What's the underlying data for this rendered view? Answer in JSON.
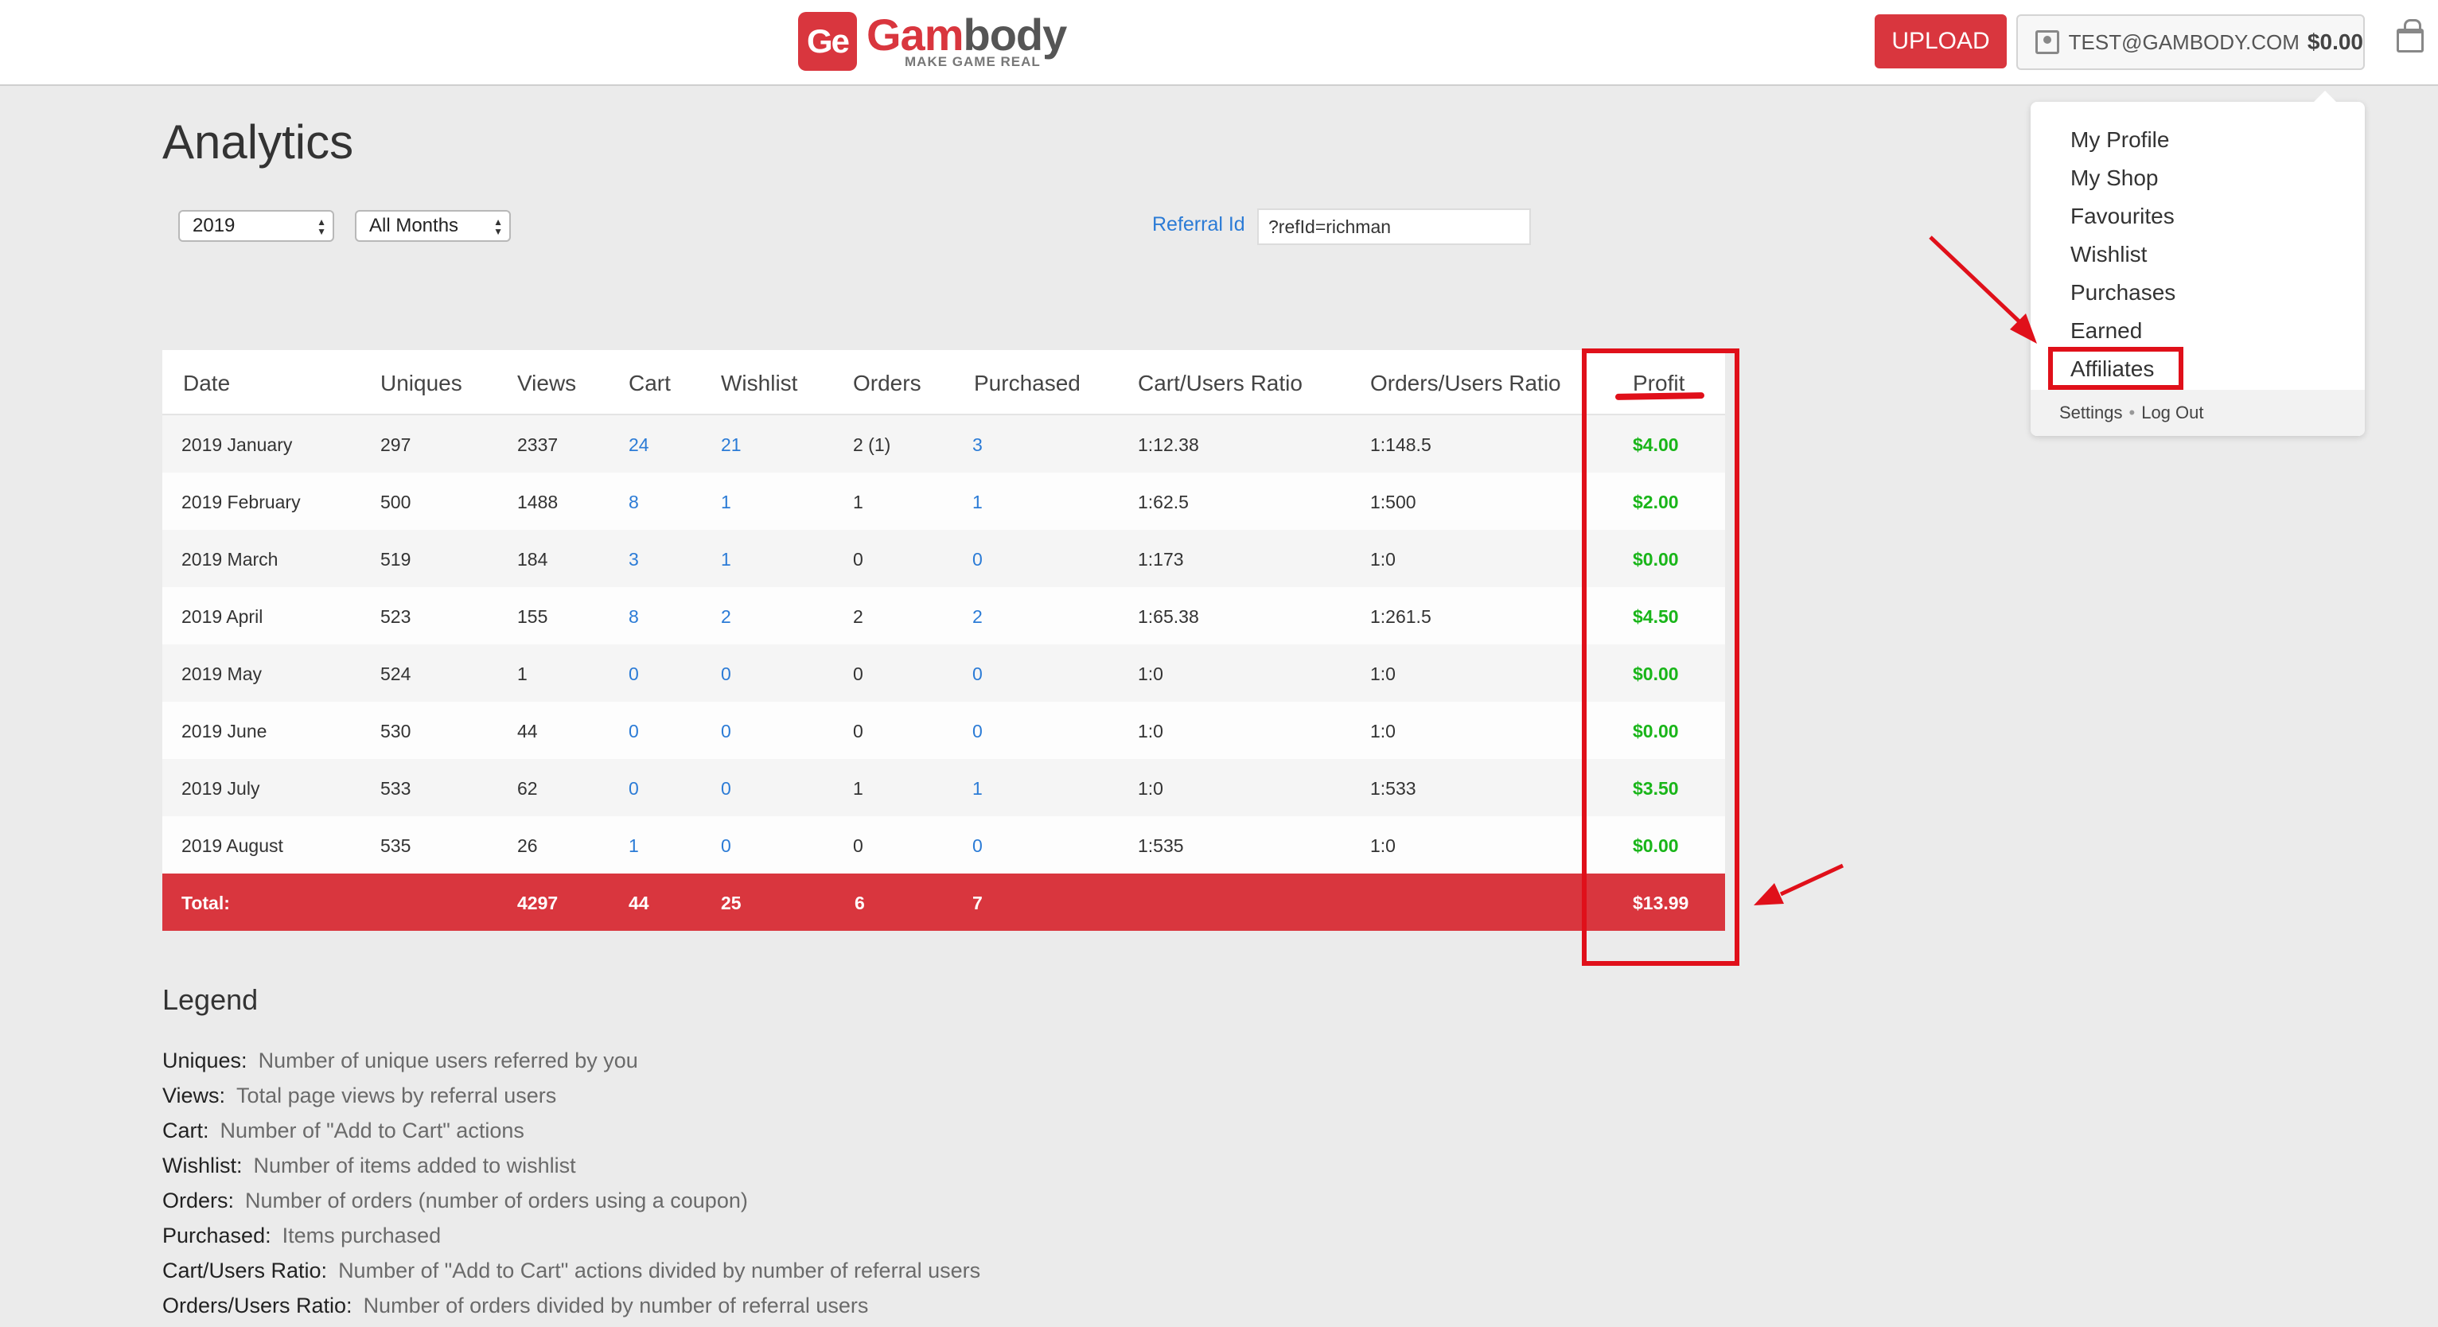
{
  "header": {
    "logo_mark": "Ge",
    "logo_word_1": "Gam",
    "logo_word_2": "body",
    "logo_tagline": "MAKE GAME REAL",
    "upload_label": "UPLOAD",
    "account_email": "TEST@GAMBODY.COM",
    "account_balance": "$0.00"
  },
  "menu": {
    "items": [
      "My Profile",
      "My Shop",
      "Favourites",
      "Wishlist",
      "Purchases",
      "Earned",
      "Affiliates"
    ],
    "settings": "Settings",
    "separator": "•",
    "logout": "Log Out"
  },
  "page": {
    "title": "Analytics",
    "year_select": "2019",
    "month_select": "All Months",
    "referral_label": "Referral Id",
    "referral_value": "?refId=richman"
  },
  "table": {
    "headers": [
      "Date",
      "Uniques",
      "Views",
      "Cart",
      "Wishlist",
      "Orders",
      "Purchased",
      "Cart/Users Ratio",
      "Orders/Users Ratio",
      "Profit"
    ],
    "rows": [
      [
        "2019 January",
        "297",
        "2337",
        "24",
        "21",
        "2 (1)",
        "3",
        "1:12.38",
        "1:148.5",
        "$4.00"
      ],
      [
        "2019 February",
        "500",
        "1488",
        "8",
        "1",
        "1",
        "1",
        "1:62.5",
        "1:500",
        "$2.00"
      ],
      [
        "2019 March",
        "519",
        "184",
        "3",
        "1",
        "0",
        "0",
        "1:173",
        "1:0",
        "$0.00"
      ],
      [
        "2019 April",
        "523",
        "155",
        "8",
        "2",
        "2",
        "2",
        "1:65.38",
        "1:261.5",
        "$4.50"
      ],
      [
        "2019 May",
        "524",
        "1",
        "0",
        "0",
        "0",
        "0",
        "1:0",
        "1:0",
        "$0.00"
      ],
      [
        "2019 June",
        "530",
        "44",
        "0",
        "0",
        "0",
        "0",
        "1:0",
        "1:0",
        "$0.00"
      ],
      [
        "2019 July",
        "533",
        "62",
        "0",
        "0",
        "1",
        "1",
        "1:0",
        "1:533",
        "$3.50"
      ],
      [
        "2019 August",
        "535",
        "26",
        "1",
        "0",
        "0",
        "0",
        "1:535",
        "1:0",
        "$0.00"
      ]
    ],
    "total": {
      "label": "Total:",
      "views": "4297",
      "cart": "44",
      "wishlist": "25",
      "orders": "6",
      "purchased": "7",
      "profit": "$13.99"
    }
  },
  "legend": {
    "title": "Legend",
    "items": [
      {
        "term": "Uniques:",
        "desc": "Number of unique users referred by you"
      },
      {
        "term": "Views:",
        "desc": "Total page views by referral users"
      },
      {
        "term": "Cart:",
        "desc": "Number of \"Add to Cart\" actions"
      },
      {
        "term": "Wishlist:",
        "desc": "Number of items added to wishlist"
      },
      {
        "term": "Orders:",
        "desc": "Number of orders (number of orders using a coupon)"
      },
      {
        "term": "Purchased:",
        "desc": "Items purchased"
      },
      {
        "term": "Cart/Users Ratio:",
        "desc": "Number of \"Add to Cart\" actions divided by number of referral users"
      },
      {
        "term": "Orders/Users Ratio:",
        "desc": "Number of orders divided by number of referral users"
      }
    ]
  },
  "colors": {
    "brand_red": "#d9363e",
    "link_blue": "#2b7bd6",
    "profit_green": "#19b519",
    "annotation_red": "#e0101a"
  }
}
